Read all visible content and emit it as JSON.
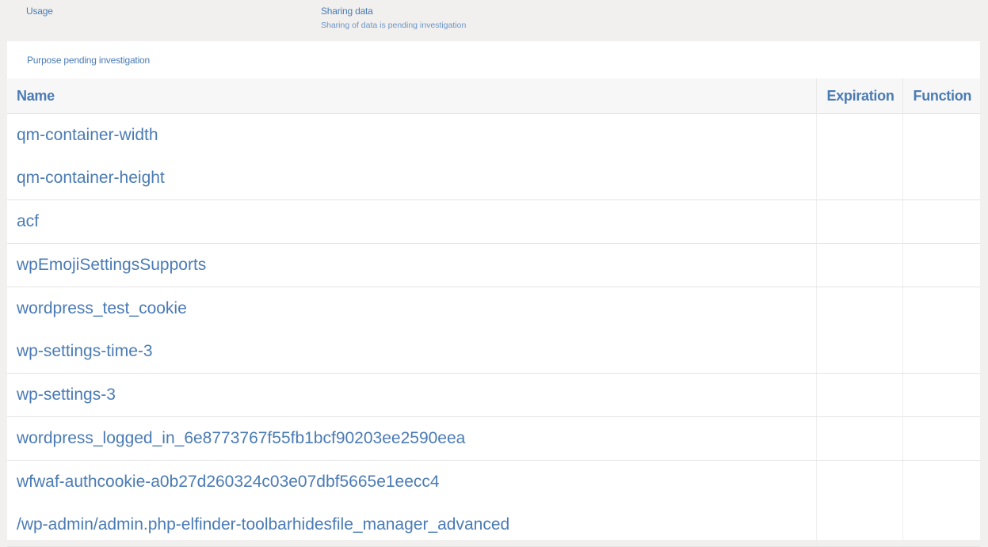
{
  "header": {
    "usage_label": "Usage",
    "sharing_label": "Sharing data",
    "sharing_sub": "Sharing of data is pending investigation"
  },
  "section": {
    "purpose_label": "Purpose pending investigation"
  },
  "table": {
    "columns": [
      "Name",
      "Expiration",
      "Function"
    ],
    "rows": [
      {
        "names": [
          "qm-container-width",
          "qm-container-height"
        ]
      },
      {
        "names": [
          "acf"
        ]
      },
      {
        "names": [
          "wpEmojiSettingsSupports"
        ]
      },
      {
        "names": [
          "wordpress_test_cookie",
          "wp-settings-time-3"
        ]
      },
      {
        "names": [
          "wp-settings-3"
        ]
      },
      {
        "names": [
          "wordpress_logged_in_6e8773767f55fb1bcf90203ee2590eea"
        ]
      },
      {
        "names": [
          "wfwaf-authcookie-a0b27d260324c03e07dbf5665e1eecc4",
          "/wp-admin/admin.php-elfinder-toolbarhidesfile_manager_advanced"
        ]
      }
    ]
  }
}
